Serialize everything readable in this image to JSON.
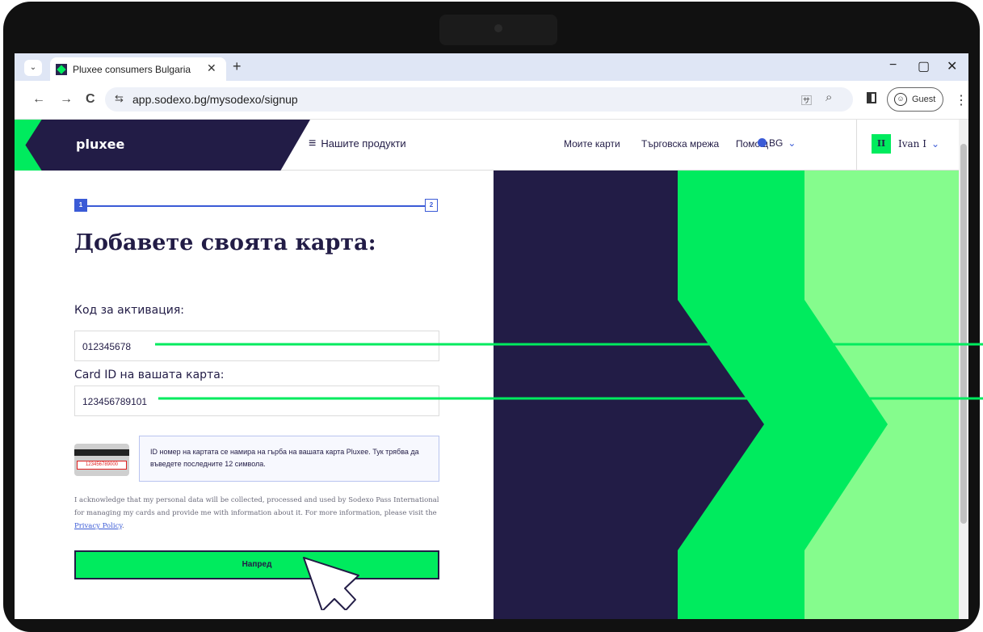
{
  "browser": {
    "tab_title": "Pluxee consumers Bulgaria",
    "tab_close": "✕",
    "new_tab": "+",
    "tab_list": "⌄",
    "url": "app.sodexo.bg/mysodexo/signup",
    "back": "←",
    "forward": "→",
    "reload": "C",
    "site_info": "⇆",
    "translate": "🈂",
    "zoom": "⌕",
    "profile_label": "Guest",
    "profile_icon": "☺",
    "menu": "⋮",
    "minimize": "−",
    "maximize": "▢",
    "close": "✕"
  },
  "header": {
    "logo": "pluxee",
    "products": "Нашите продукти",
    "burger": "≡",
    "nav": [
      "Моите карти",
      "Търговска мрежа",
      "Помощ"
    ],
    "language": "BG",
    "chevron": "⌄",
    "avatar_initials": "II",
    "user_name": "Ivan I"
  },
  "steps": {
    "current": "1",
    "next": "2"
  },
  "form": {
    "title": "Добавете своята карта:",
    "activation_label": "Код за активация:",
    "activation_value": "012345678",
    "card_id_label": "Card ID на вашата карта:",
    "card_id_value": "123456789101",
    "card_sample_number": "123456789000",
    "info_text": "ID номер на картата се намира на гърба на вашата карта Pluxee. Тук трябва да въведете последните 12 символа.",
    "consent_text": "I acknowledge that my personal data will be collected, processed and used by Sodexo Pass International for managing my cards and provide me with information about it. For more information, please visit the",
    "privacy_link": "Privacy Policy",
    "consent_end": ".",
    "submit": "Напред"
  },
  "colors": {
    "navy": "#221c46",
    "green": "#00eb5e",
    "light_green": "#85fc8d",
    "blue": "#3b5bd6"
  }
}
